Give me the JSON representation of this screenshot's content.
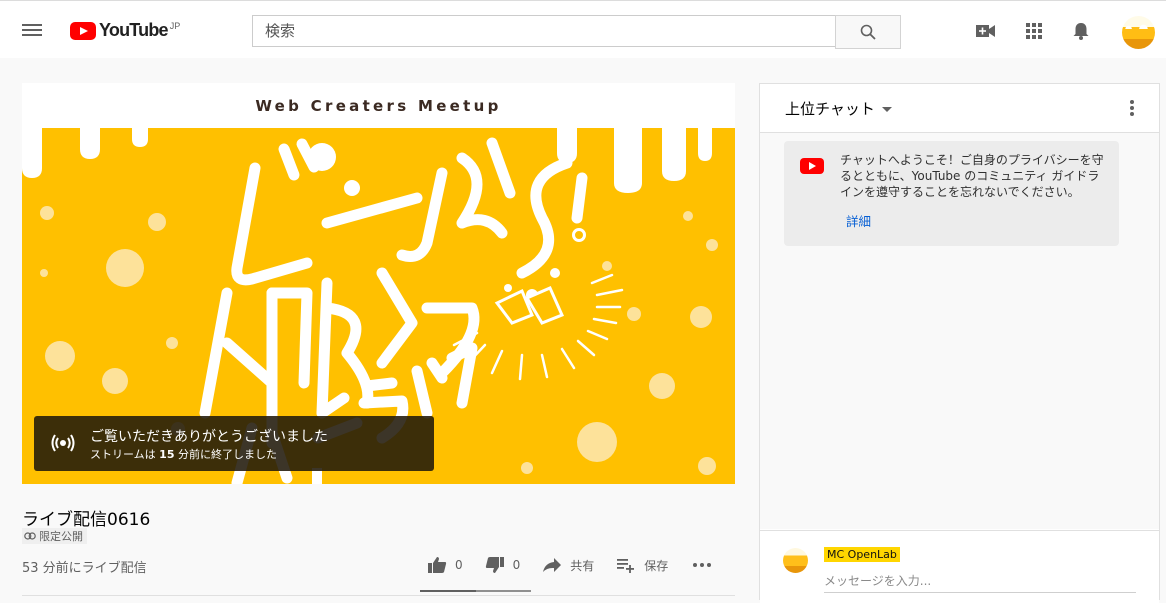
{
  "header": {
    "logo_text": "YouTube",
    "logo_region": "JP",
    "search": {
      "placeholder": "検索",
      "value": ""
    },
    "icons": [
      "menu-icon",
      "search-icon",
      "video-camera-add-icon",
      "apps-grid-icon",
      "bell-icon",
      "avatar"
    ]
  },
  "player": {
    "banner_text": "Web Creaters Meetup",
    "artwork_lettering": [
      "ビールで",
      "人脈づくり!",
      "オンライン"
    ],
    "overlay": {
      "title": "ご覧いただきありがとうございました",
      "sub_prefix": "ストリームは",
      "sub_count": "15",
      "sub_suffix": "分前に終了しました"
    },
    "colors": {
      "background": "#ffc000",
      "overlay": "#21190a"
    }
  },
  "video": {
    "title": "ライブ配信0616",
    "privacy": "限定公開",
    "date": "53 分前にライブ配信",
    "actions": {
      "like_count": "0",
      "dislike_count": "0",
      "share_label": "共有",
      "save_label": "保存"
    },
    "like_ratio": 0.5
  },
  "chat": {
    "mode_label": "上位チャット",
    "welcome_text": "チャットへようこそ！ご自身のプライバシーを守るとともに、YouTube のコミュニティ ガイドラインを遵守することを忘れないでください。",
    "welcome_link": "詳細",
    "user_name": "MC OpenLab",
    "input_placeholder": "メッセージを入力..."
  }
}
